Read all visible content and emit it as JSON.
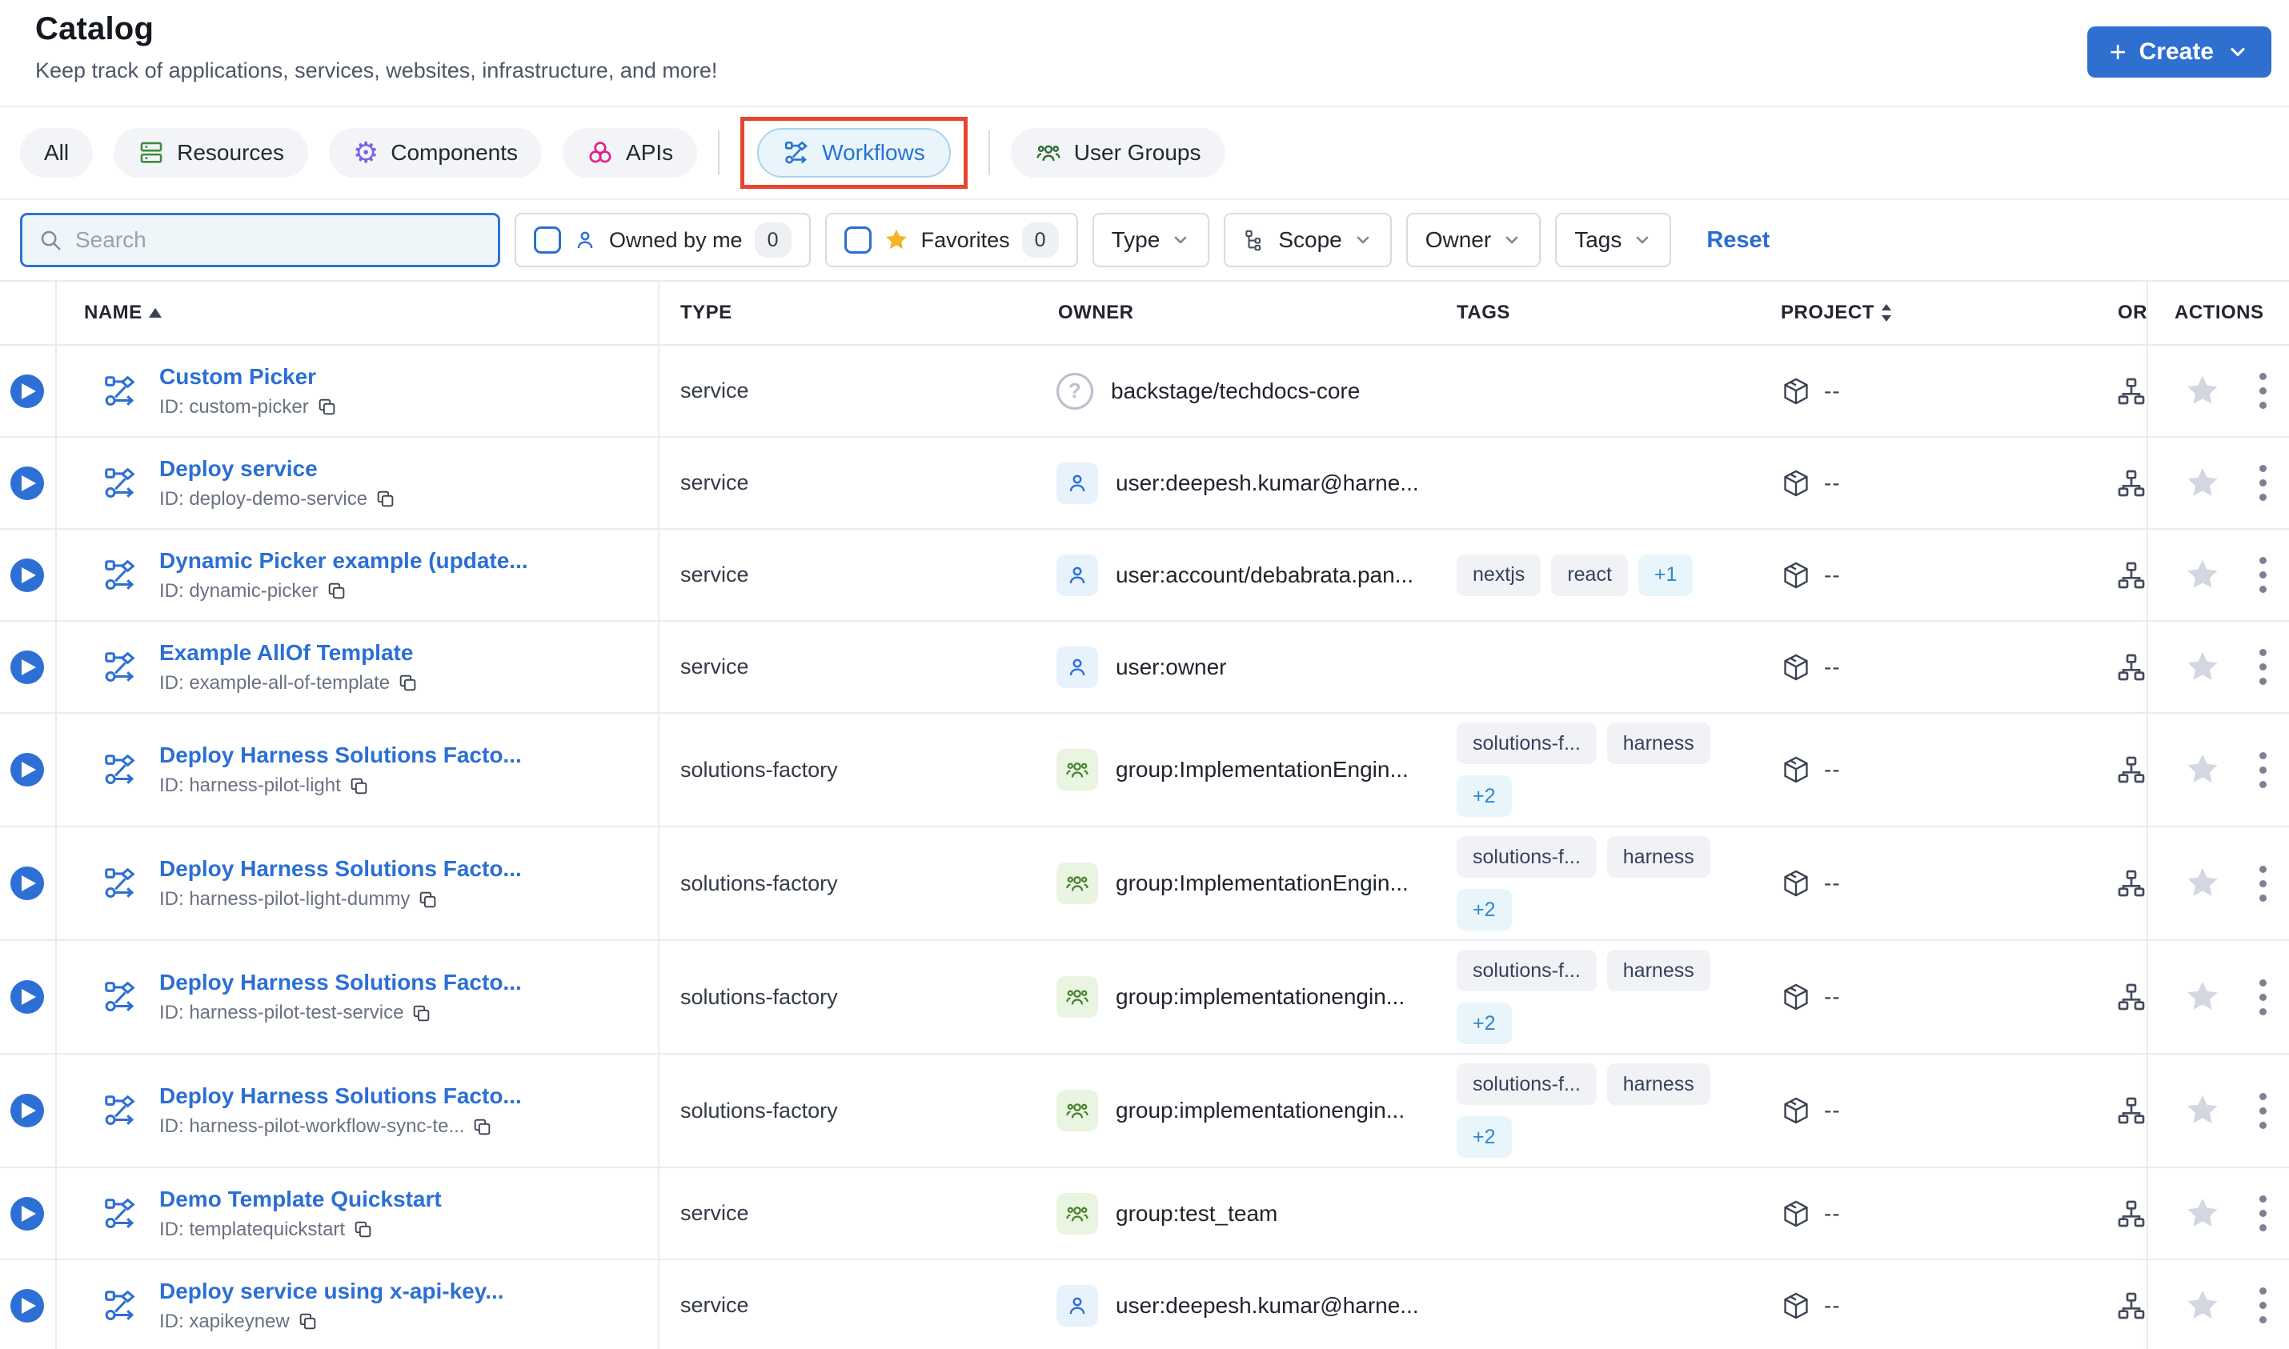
{
  "page": {
    "title": "Catalog",
    "subtitle": "Keep track of applications, services, websites, infrastructure, and more!"
  },
  "create_button": {
    "label": "Create",
    "plus": "+"
  },
  "tabs": [
    {
      "label": "All"
    },
    {
      "label": "Resources",
      "icon": "resources-icon"
    },
    {
      "label": "Components",
      "icon": "components-icon"
    },
    {
      "label": "APIs",
      "icon": "apis-icon"
    },
    {
      "label": "Workflows",
      "icon": "workflows-icon",
      "active": true,
      "annotated": true
    },
    {
      "label": "User Groups",
      "icon": "user-groups-icon"
    }
  ],
  "filters": {
    "search_placeholder": "Search",
    "owned_by_me": {
      "label": "Owned by me",
      "count": "0"
    },
    "favorites": {
      "label": "Favorites",
      "count": "0"
    },
    "dropdowns": [
      {
        "label": "Type"
      },
      {
        "label": "Scope",
        "icon": "hierarchy-icon"
      },
      {
        "label": "Owner"
      },
      {
        "label": "Tags"
      }
    ],
    "reset_label": "Reset"
  },
  "table": {
    "columns": {
      "name": "NAME",
      "type": "TYPE",
      "owner": "OWNER",
      "tags": "TAGS",
      "project": "PROJECT",
      "org": "OR",
      "actions": "ACTIONS"
    },
    "rows": [
      {
        "name": "Custom Picker",
        "id": "ID: custom-picker",
        "type": "service",
        "owner": "backstage/techdocs-core",
        "owner_icon": "question",
        "tags": [],
        "project": "--"
      },
      {
        "name": "Deploy service",
        "id": "ID: deploy-demo-service",
        "type": "service",
        "owner": "user:deepesh.kumar@harne...",
        "owner_icon": "user",
        "tags": [],
        "project": "--"
      },
      {
        "name": "Dynamic Picker example (update...",
        "id": "ID: dynamic-picker",
        "type": "service",
        "owner": "user:account/debabrata.pan...",
        "owner_icon": "user",
        "tags": [
          "nextjs",
          "react"
        ],
        "more": "+1",
        "tags_inline": true,
        "project": "--"
      },
      {
        "name": "Example AllOf Template",
        "id": "ID: example-all-of-template",
        "type": "service",
        "owner": "user:owner",
        "owner_icon": "user",
        "tags": [],
        "project": "--"
      },
      {
        "name": "Deploy Harness Solutions Facto...",
        "id": "ID: harness-pilot-light",
        "type": "solutions-factory",
        "owner": "group:ImplementationEngin...",
        "owner_icon": "group",
        "tags": [
          "solutions-f...",
          "harness"
        ],
        "more": "+2",
        "tall": true,
        "project": "--"
      },
      {
        "name": "Deploy Harness Solutions Facto...",
        "id": "ID: harness-pilot-light-dummy",
        "type": "solutions-factory",
        "owner": "group:ImplementationEngin...",
        "owner_icon": "group",
        "tags": [
          "solutions-f...",
          "harness"
        ],
        "more": "+2",
        "tall": true,
        "project": "--"
      },
      {
        "name": "Deploy Harness Solutions Facto...",
        "id": "ID: harness-pilot-test-service",
        "type": "solutions-factory",
        "owner": "group:implementationengin...",
        "owner_icon": "group",
        "tags": [
          "solutions-f...",
          "harness"
        ],
        "more": "+2",
        "tall": true,
        "project": "--"
      },
      {
        "name": "Deploy Harness Solutions Facto...",
        "id": "ID: harness-pilot-workflow-sync-te...",
        "type": "solutions-factory",
        "owner": "group:implementationengin...",
        "owner_icon": "group",
        "tags": [
          "solutions-f...",
          "harness"
        ],
        "more": "+2",
        "tall": true,
        "project": "--"
      },
      {
        "name": "Demo Template Quickstart",
        "id": "ID: templatequickstart",
        "type": "service",
        "owner": "group:test_team",
        "owner_icon": "group",
        "tags": [],
        "project": "--"
      },
      {
        "name": "Deploy service using x-api-key...",
        "id": "ID: xapikeynew",
        "type": "service",
        "owner": "user:deepesh.kumar@harne...",
        "owner_icon": "user",
        "tags": [],
        "project": "--"
      }
    ]
  },
  "colors": {
    "accent_blue": "#2e6fd0",
    "annotation_red": "#e5462f",
    "active_tab_bg": "#e9f5fb",
    "tag_more_blue": "#2e86cc",
    "star_gold": "#f3b624",
    "resources_green": "#3d8b40",
    "components_purple": "#7b61e3",
    "apis_pink": "#e0218a",
    "groups_green": "#47822f",
    "star_inactive": "#d2d7e1"
  }
}
